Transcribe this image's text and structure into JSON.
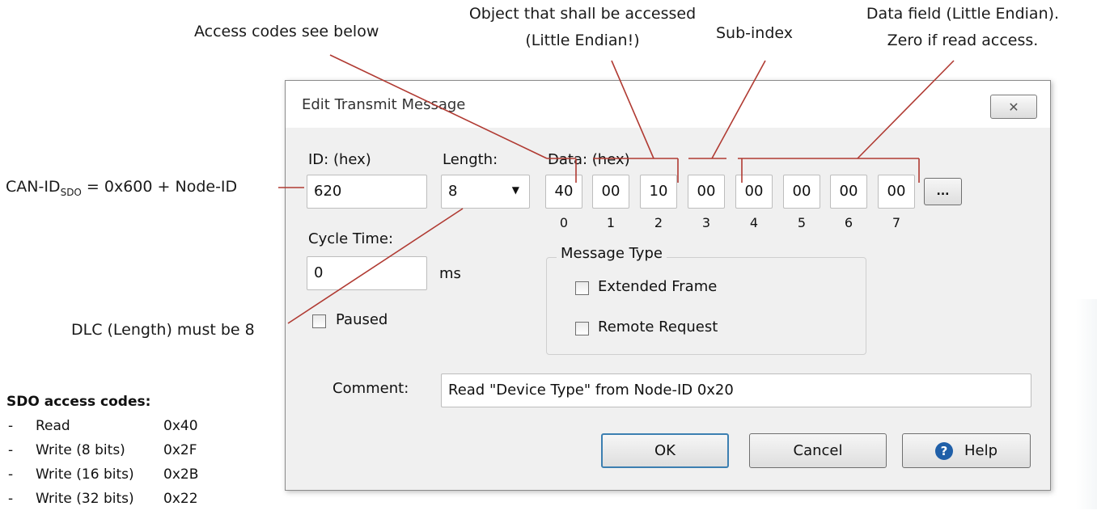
{
  "annotations": {
    "access_codes": "Access codes see below",
    "object_line1": "Object that shall be accessed",
    "object_line2": "(Little Endian!)",
    "subindex": "Sub-index",
    "datafield_line1": "Data field (Little Endian).",
    "datafield_line2": "Zero if read access.",
    "canid_prefix": "CAN-ID",
    "canid_sub": "SDO",
    "canid_suffix": " = 0x600 + Node-ID",
    "dlc": "DLC (Length) must be 8"
  },
  "dialog": {
    "title": "Edit Transmit Message",
    "close_glyph": "✕",
    "id_label": "ID: (hex)",
    "id_value": "620",
    "length_label": "Length:",
    "length_value": "8",
    "data_label": "Data: (hex)",
    "data_bytes": [
      "40",
      "00",
      "10",
      "00",
      "00",
      "00",
      "00",
      "00"
    ],
    "byte_indices": [
      "0",
      "1",
      "2",
      "3",
      "4",
      "5",
      "6",
      "7"
    ],
    "more_button": "...",
    "cycle_label": "Cycle Time:",
    "cycle_value": "0",
    "cycle_unit": "ms",
    "paused_label": "Paused",
    "paused_checked": false,
    "message_type": {
      "title": "Message Type",
      "extended_label": "Extended Frame",
      "extended_checked": false,
      "remote_label": "Remote Request",
      "remote_checked": false
    },
    "comment_label": "Comment:",
    "comment_value": "Read \"Device Type\" from Node-ID 0x20",
    "ok_label": "OK",
    "cancel_label": "Cancel",
    "help_label": "Help"
  },
  "sdo_codes": {
    "title": "SDO access codes:",
    "items": [
      {
        "name": "Read",
        "code": "0x40"
      },
      {
        "name": "Write (8 bits)",
        "code": "0x2F"
      },
      {
        "name": "Write (16 bits)",
        "code": "0x2B"
      },
      {
        "name": "Write (32 bits)",
        "code": "0x22"
      }
    ]
  },
  "colors": {
    "annotation_line": "#b03a32",
    "dialog_bg": "#f0f0f0",
    "ok_border": "#3c7fb1",
    "help_icon": "#1f5fa8"
  }
}
